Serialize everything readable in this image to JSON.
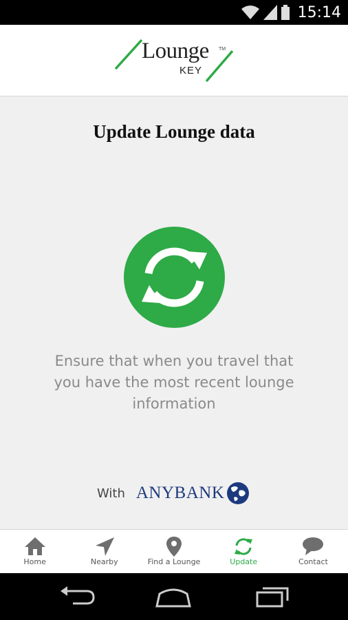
{
  "status_bar": {
    "time": "15:14"
  },
  "header": {
    "logo_word": "Lounge",
    "logo_sub": "KEY",
    "logo_tm": "TM"
  },
  "main": {
    "title": "Update Lounge data",
    "description": "Ensure that when you travel that you have the most recent lounge information",
    "with_label": "With",
    "bank_name": "ANYBANK"
  },
  "tabs": [
    {
      "label": "Home",
      "icon": "home-icon",
      "active": false
    },
    {
      "label": "Nearby",
      "icon": "navigation-arrow-icon",
      "active": false
    },
    {
      "label": "Find a Lounge",
      "icon": "map-pin-icon",
      "active": false
    },
    {
      "label": "Update",
      "icon": "refresh-icon",
      "active": true
    },
    {
      "label": "Contact",
      "icon": "chat-bubble-icon",
      "active": false
    }
  ],
  "colors": {
    "accent_green": "#2eaa47",
    "bank_blue": "#1d3a7e",
    "tab_icon_grey": "#8a8a8a"
  }
}
